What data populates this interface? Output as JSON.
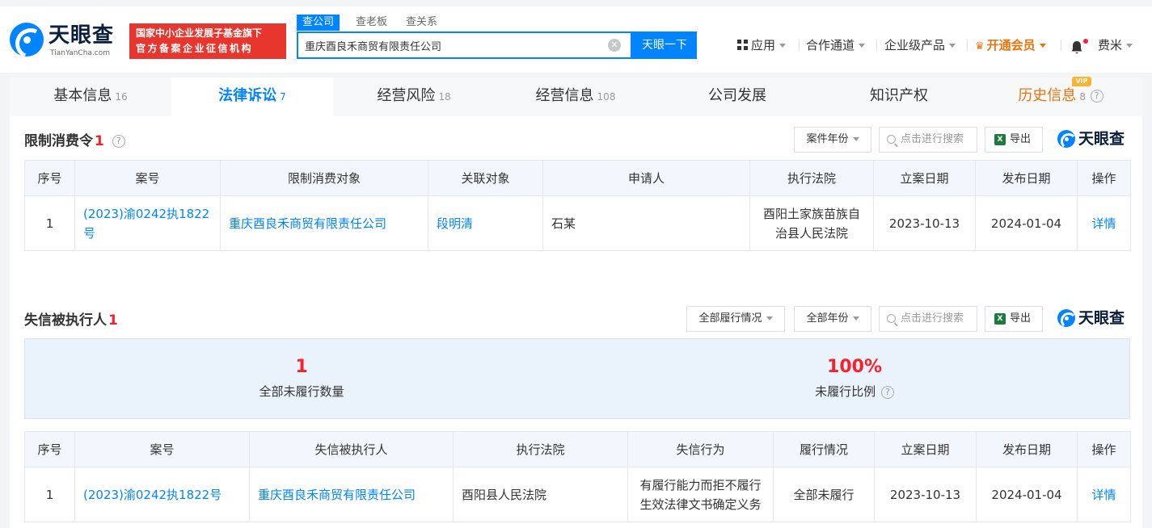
{
  "header": {
    "logo_name": "天眼查",
    "logo_sub": "TianYanCha.com",
    "badge_line1": "国家中小企业发展子基金旗下",
    "badge_line2": "官方备案企业征信机构",
    "search_tabs": [
      "查公司",
      "查老板",
      "查关系"
    ],
    "search_value": "重庆酉良禾商贸有限责任公司",
    "search_button": "天眼一下",
    "nav": {
      "apps": "应用",
      "channels": "合作通道",
      "enterprise": "企业级产品",
      "vip": "开通会员",
      "user": "费米"
    }
  },
  "tabs": [
    {
      "label": "基本信息",
      "count": "16"
    },
    {
      "label": "法律诉讼",
      "count": "7"
    },
    {
      "label": "经营风险",
      "count": "18"
    },
    {
      "label": "经营信息",
      "count": "108"
    },
    {
      "label": "公司发展",
      "count": ""
    },
    {
      "label": "知识产权",
      "count": ""
    },
    {
      "label": "历史信息",
      "count": "8"
    }
  ],
  "vip_tag": "VIP",
  "restriction": {
    "title": "限制消费令",
    "count": "1",
    "filter_year": "案件年份",
    "search_placeholder": "点击进行搜索",
    "export": "导出",
    "brand": "天眼查",
    "columns": [
      "序号",
      "案号",
      "限制消费对象",
      "关联对象",
      "申请人",
      "执行法院",
      "立案日期",
      "发布日期",
      "操作"
    ],
    "rows": [
      {
        "index": "1",
        "case_no": "(2023)渝0242执1822号",
        "target": "重庆酉良禾商贸有限责任公司",
        "related": "段明清",
        "applicant": "石某",
        "court": "酉阳土家族苗族自治县人民法院",
        "filed": "2023-10-13",
        "published": "2024-01-04",
        "action": "详情"
      }
    ]
  },
  "dishonest": {
    "title": "失信被执行人",
    "count": "1",
    "filter_status": "全部履行情况",
    "filter_year": "全部年份",
    "search_placeholder": "点击进行搜索",
    "export": "导出",
    "brand": "天眼查",
    "stats": [
      {
        "value": "1",
        "label": "全部未履行数量"
      },
      {
        "value": "100%",
        "label": "未履行比例"
      }
    ],
    "columns": [
      "序号",
      "案号",
      "失信被执行人",
      "执行法院",
      "失信行为",
      "履行情况",
      "立案日期",
      "发布日期",
      "操作"
    ],
    "rows": [
      {
        "index": "1",
        "case_no": "(2023)渝0242执1822号",
        "person": "重庆酉良禾商贸有限责任公司",
        "court": "酉阳县人民法院",
        "behavior": "有履行能力而拒不履行生效法律文书确定义务",
        "status": "全部未履行",
        "filed": "2023-10-13",
        "published": "2024-01-04",
        "action": "详情"
      }
    ]
  },
  "colors": {
    "accent": "#0084ff",
    "danger": "#f5222d",
    "vip": "#e8740c",
    "badge": "#e6362d"
  }
}
